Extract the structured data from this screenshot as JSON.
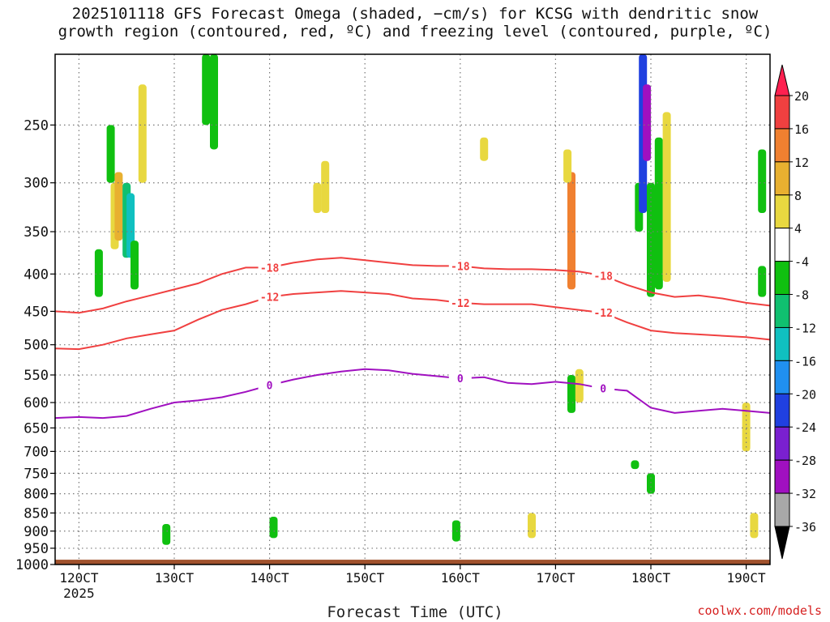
{
  "title_line1": "2025101118 GFS Forecast Omega (shaded, −cm/s) for KCSG with dendritic snow",
  "title_line2": "growth region (contoured, red, ºC) and freezing level (contoured, purple, ºC)",
  "credit": "coolwx.com/models",
  "chart_data": {
    "type": "heatmap",
    "xlabel": "Forecast Time (UTC)",
    "x_tick_labels": [
      "120CT",
      "130CT",
      "140CT",
      "150CT",
      "160CT",
      "170CT",
      "180CT",
      "190CT"
    ],
    "x_tick_hours": [
      6,
      30,
      54,
      78,
      102,
      126,
      150,
      174
    ],
    "x_sub_label": "2025",
    "xlim_hours": [
      0,
      180
    ],
    "y_tick_labels": [
      "250",
      "300",
      "350",
      "400",
      "450",
      "500",
      "550",
      "600",
      "650",
      "700",
      "750",
      "800",
      "850",
      "900",
      "950",
      "1000"
    ],
    "y_axis_scale": "pressure (hPa), decreasing upward",
    "ylim_hpa": [
      1000,
      200
    ],
    "grid": true,
    "colorbar": {
      "tick_labels": [
        "20",
        "16",
        "12",
        "8",
        "4",
        "-4",
        "-8",
        "-12",
        "-16",
        "-20",
        "-24",
        "-28",
        "-32",
        "-36"
      ],
      "colors": [
        "#ff2050",
        "#f04040",
        "#f08030",
        "#e8b030",
        "#e8d840",
        "#ffffff",
        "#10c010",
        "#10c070",
        "#10c0c0",
        "#2090f0",
        "#2040e0",
        "#7a20d0",
        "#a010c0",
        "#a8a8a8",
        "#000000"
      ]
    },
    "ground_color": "#a0522d",
    "contours": [
      {
        "label": "-18",
        "color": "#f04040",
        "x": [
          0,
          6,
          12,
          18,
          24,
          30,
          36,
          42,
          48,
          54,
          60,
          66,
          72,
          78,
          84,
          90,
          96,
          102,
          108,
          114,
          120,
          126,
          132,
          138,
          144,
          150,
          156,
          162,
          168,
          174,
          180
        ],
        "y": [
          450,
          452,
          446,
          436,
          428,
          420,
          412,
          400,
          392,
          392,
          386,
          382,
          380,
          383,
          386,
          389,
          390,
          390,
          393,
          394,
          394,
          395,
          397,
          402,
          414,
          424,
          430,
          428,
          432,
          438,
          442
        ]
      },
      {
        "label": "-12",
        "color": "#f04040",
        "x": [
          0,
          6,
          12,
          18,
          24,
          30,
          36,
          42,
          48,
          54,
          60,
          66,
          72,
          78,
          84,
          90,
          96,
          102,
          108,
          114,
          120,
          126,
          132,
          138,
          144,
          150,
          156,
          162,
          168,
          174,
          180
        ],
        "y": [
          506,
          507,
          500,
          490,
          484,
          478,
          462,
          448,
          440,
          430,
          426,
          424,
          422,
          424,
          426,
          432,
          434,
          438,
          440,
          440,
          440,
          444,
          448,
          452,
          466,
          478,
          482,
          484,
          486,
          488,
          492
        ]
      },
      {
        "label": "0",
        "color": "#a010c0",
        "x": [
          0,
          6,
          12,
          18,
          24,
          30,
          36,
          42,
          48,
          54,
          60,
          66,
          72,
          78,
          84,
          90,
          96,
          102,
          108,
          114,
          120,
          126,
          132,
          138,
          144,
          150,
          156,
          162,
          168,
          174,
          180
        ],
        "y": [
          630,
          628,
          630,
          626,
          612,
          600,
          596,
          590,
          580,
          568,
          558,
          550,
          544,
          540,
          542,
          548,
          552,
          556,
          554,
          564,
          566,
          562,
          566,
          574,
          578,
          610,
          620,
          616,
          612,
          616,
          620
        ]
      }
    ],
    "omega_cells": [
      {
        "hr": 14,
        "p0": 250,
        "p1": 300,
        "v": -4
      },
      {
        "hr": 15,
        "p0": 300,
        "p1": 370,
        "v": 4
      },
      {
        "hr": 16,
        "p0": 290,
        "p1": 360,
        "v": 8
      },
      {
        "hr": 18,
        "p0": 300,
        "p1": 380,
        "v": -12
      },
      {
        "hr": 19,
        "p0": 310,
        "p1": 380,
        "v": -16
      },
      {
        "hr": 20,
        "p0": 360,
        "p1": 420,
        "v": -4
      },
      {
        "hr": 22,
        "p0": 220,
        "p1": 300,
        "v": 4
      },
      {
        "hr": 11,
        "p0": 370,
        "p1": 430,
        "v": -4
      },
      {
        "hr": 38,
        "p0": 200,
        "p1": 250,
        "v": -4
      },
      {
        "hr": 40,
        "p0": 200,
        "p1": 270,
        "v": -4
      },
      {
        "hr": 68,
        "p0": 280,
        "p1": 330,
        "v": 4
      },
      {
        "hr": 130,
        "p0": 290,
        "p1": 420,
        "v": 12
      },
      {
        "hr": 129,
        "p0": 270,
        "p1": 300,
        "v": 4
      },
      {
        "hr": 147,
        "p0": 300,
        "p1": 350,
        "v": -4
      },
      {
        "hr": 148,
        "p0": 200,
        "p1": 330,
        "v": -24
      },
      {
        "hr": 149,
        "p0": 220,
        "p1": 280,
        "v": -32
      },
      {
        "hr": 150,
        "p0": 300,
        "p1": 430,
        "v": -8
      },
      {
        "hr": 152,
        "p0": 260,
        "p1": 420,
        "v": -4
      },
      {
        "hr": 154,
        "p0": 240,
        "p1": 410,
        "v": 4
      },
      {
        "hr": 178,
        "p0": 270,
        "p1": 330,
        "v": -8
      },
      {
        "hr": 178,
        "p0": 390,
        "p1": 430,
        "v": -8
      },
      {
        "hr": 130,
        "p0": 550,
        "p1": 620,
        "v": -8
      },
      {
        "hr": 132,
        "p0": 540,
        "p1": 600,
        "v": 4
      },
      {
        "hr": 28,
        "p0": 880,
        "p1": 940,
        "v": -8
      },
      {
        "hr": 55,
        "p0": 860,
        "p1": 920,
        "v": -8
      },
      {
        "hr": 101,
        "p0": 870,
        "p1": 930,
        "v": -8
      },
      {
        "hr": 120,
        "p0": 850,
        "p1": 920,
        "v": 4
      },
      {
        "hr": 176,
        "p0": 850,
        "p1": 920,
        "v": 4
      },
      {
        "hr": 174,
        "p0": 600,
        "p1": 700,
        "v": 4
      },
      {
        "hr": 146,
        "p0": 720,
        "p1": 740,
        "v": -8
      },
      {
        "hr": 150,
        "p0": 750,
        "p1": 800,
        "v": -8
      },
      {
        "hr": 66,
        "p0": 300,
        "p1": 330,
        "v": 4
      },
      {
        "hr": 108,
        "p0": 260,
        "p1": 280,
        "v": 4
      }
    ]
  }
}
